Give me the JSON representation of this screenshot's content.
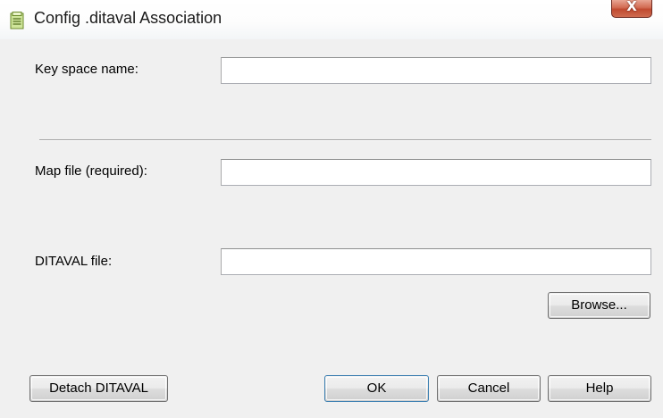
{
  "window": {
    "title": "Config .ditaval Association",
    "close_glyph": "X"
  },
  "form": {
    "key_space": {
      "label": "Key space name:",
      "value": ""
    },
    "map_file": {
      "label": "Map file (required):",
      "value": ""
    },
    "ditaval_file": {
      "label": "DITAVAL file:",
      "value": ""
    }
  },
  "buttons": {
    "browse": "Browse...",
    "detach": "Detach DITAVAL",
    "ok": "OK",
    "cancel": "Cancel",
    "help": "Help"
  },
  "icons": {
    "title": "document-icon",
    "close": "close-icon"
  },
  "colors": {
    "close_button": "#c94f35",
    "window_bg": "#f0f0f0"
  }
}
